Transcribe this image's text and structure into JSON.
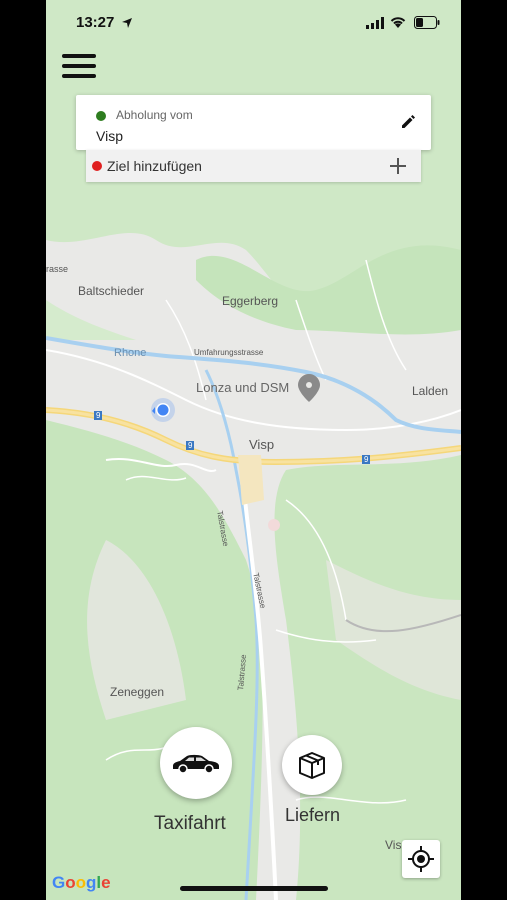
{
  "status_bar": {
    "time": "13:27"
  },
  "pickup": {
    "label": "Abholung vom",
    "value": "Visp"
  },
  "destination": {
    "label": "Ziel hinzufügen"
  },
  "map": {
    "labels": {
      "baltschieder": "Baltschieder",
      "eggerberg": "Eggerberg",
      "rhone": "Rhone",
      "umfahrungsstrasse": "Umfahrungsstrasse",
      "lonza": "Lonza und DSM",
      "lalden": "Lalden",
      "visp": "Visp",
      "zeneggen": "Zeneggen",
      "talstrasse_1": "Talstrasse",
      "talstrasse_2": "Talstrasse",
      "talstrasse_3": "Talstrasse",
      "visp_corner": "Vis    nine",
      "strasse_edge": "rasse",
      "route_9_a": "9",
      "route_9_b": "9",
      "route_9_c": "9"
    }
  },
  "services": {
    "taxi": "Taxifahrt",
    "delivery": "Liefern"
  },
  "attribution": "Google",
  "colors": {
    "pickup_dot": "#2e7d1f",
    "destination_dot": "#e02020",
    "location_dot": "#4285f4",
    "map_green": "#c9e7c0",
    "river": "#a8d0f0",
    "highway": "#f5d77a"
  }
}
